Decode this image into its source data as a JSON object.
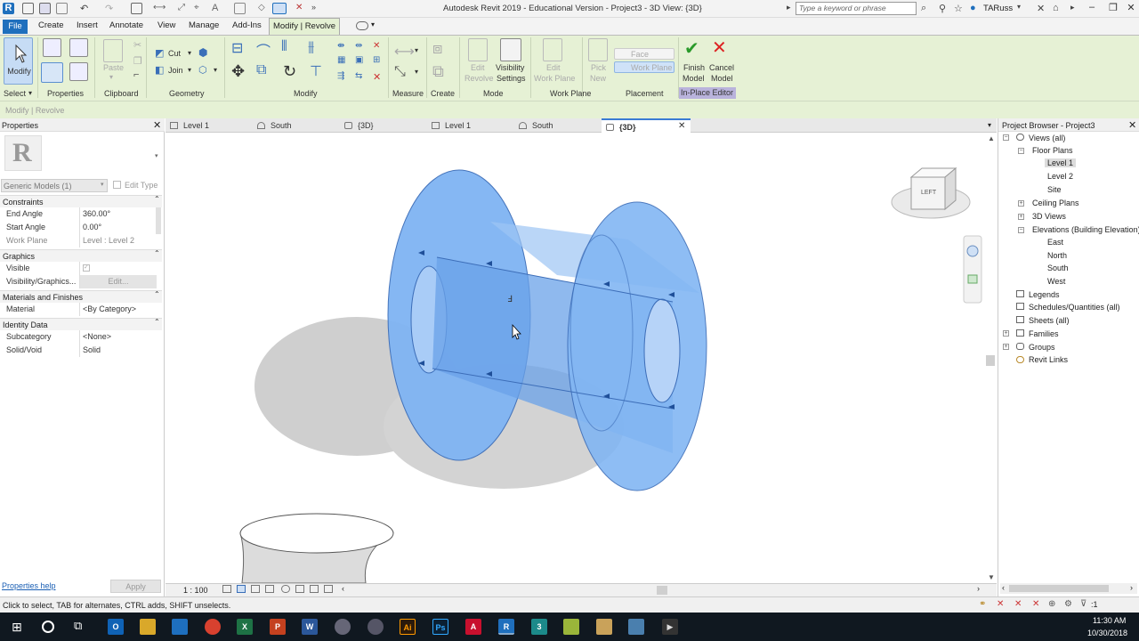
{
  "app": {
    "title": "Autodesk Revit 2019 - Educational Version - Project3 - 3D View: {3D}",
    "search_placeholder": "Type a keyword or phrase",
    "user": "TARuss"
  },
  "ribbon_tabs": [
    "File",
    "Create",
    "Insert",
    "Annotate",
    "View",
    "Manage",
    "Add-Ins",
    "Modify | Revolve"
  ],
  "ribbon": {
    "select": "Select",
    "modify": "Modify",
    "properties": "Properties",
    "paste": "Paste",
    "clipboard": "Clipboard",
    "cut": "Cut",
    "join": "Join",
    "geometry": "Geometry",
    "modify_panel": "Modify",
    "measure": "Measure",
    "create": "Create",
    "edit_revolve": [
      "Edit",
      "Revolve"
    ],
    "visibility_settings": [
      "Visibility",
      "Settings"
    ],
    "mode": "Mode",
    "edit_work_plane": [
      "Edit",
      "Work Plane"
    ],
    "work_plane": "Work Plane",
    "pick_new": [
      "Pick",
      "New"
    ],
    "face": "Face",
    "work_plane_btn": "Work Plane",
    "placement": "Placement",
    "finish_model": [
      "Finish",
      "Model"
    ],
    "cancel_model": [
      "Cancel",
      "Model"
    ],
    "in_place_editor": "In-Place Editor",
    "context": "Modify | Revolve"
  },
  "properties": {
    "title": "Properties",
    "type_selector": "Generic Models (1)",
    "edit_type": "Edit Type",
    "groups": [
      {
        "name": "Constraints",
        "rows": [
          {
            "k": "End Angle",
            "v": "360.00°"
          },
          {
            "k": "Start Angle",
            "v": "0.00°"
          },
          {
            "k": "Work Plane",
            "v": "Level : Level 2"
          }
        ]
      },
      {
        "name": "Graphics",
        "rows": [
          {
            "k": "Visible",
            "v": ""
          },
          {
            "k": "Visibility/Graphics...",
            "v": "Edit..."
          }
        ]
      },
      {
        "name": "Materials and Finishes",
        "rows": [
          {
            "k": "Material",
            "v": "<By Category>"
          }
        ]
      },
      {
        "name": "Identity Data",
        "rows": [
          {
            "k": "Subcategory",
            "v": "<None>"
          },
          {
            "k": "Solid/Void",
            "v": "Solid"
          }
        ]
      }
    ],
    "help": "Properties help",
    "apply": "Apply"
  },
  "view_tabs": [
    {
      "label": "Level 1",
      "icon": "floor-plan-icon"
    },
    {
      "label": "South",
      "icon": "elevation-icon"
    },
    {
      "label": "{3D}",
      "icon": "3d-view-icon"
    },
    {
      "label": "Level 1",
      "icon": "floor-plan-icon"
    },
    {
      "label": "South",
      "icon": "elevation-icon"
    },
    {
      "label": "{3D}",
      "icon": "3d-view-icon",
      "active": true
    }
  ],
  "view": {
    "scale": "1 : 100",
    "viewcube_face": "LEFT"
  },
  "browser": {
    "title": "Project Browser - Project3",
    "nodes": [
      {
        "label": "Views (all)",
        "depth": 0,
        "tog": "-"
      },
      {
        "label": "Floor Plans",
        "depth": 1,
        "tog": "-"
      },
      {
        "label": "Level 1",
        "depth": 2,
        "selected": true
      },
      {
        "label": "Level 2",
        "depth": 2
      },
      {
        "label": "Site",
        "depth": 2
      },
      {
        "label": "Ceiling Plans",
        "depth": 1,
        "tog": "+"
      },
      {
        "label": "3D Views",
        "depth": 1,
        "tog": "+"
      },
      {
        "label": "Elevations (Building Elevation)",
        "depth": 1,
        "tog": "-"
      },
      {
        "label": "East",
        "depth": 2
      },
      {
        "label": "North",
        "depth": 2
      },
      {
        "label": "South",
        "depth": 2
      },
      {
        "label": "West",
        "depth": 2
      },
      {
        "label": "Legends",
        "depth": 0
      },
      {
        "label": "Schedules/Quantities (all)",
        "depth": 0
      },
      {
        "label": "Sheets (all)",
        "depth": 0
      },
      {
        "label": "Families",
        "depth": 0,
        "tog": "+"
      },
      {
        "label": "Groups",
        "depth": 0,
        "tog": "+"
      },
      {
        "label": "Revit Links",
        "depth": 0
      }
    ]
  },
  "status": {
    "text": "Click to select, TAB for alternates, CTRL adds, SHIFT unselects.",
    "filter_count": ":1"
  },
  "taskbar": {
    "time": "11:30 AM",
    "date": "10/30/2018"
  },
  "colors": {
    "ribbon_bg": "#e6f1d5",
    "accent_blue": "#1f6fbd",
    "model_blue": "#6aa8f0",
    "in_place_editor_bg": "#b9b3dc"
  }
}
